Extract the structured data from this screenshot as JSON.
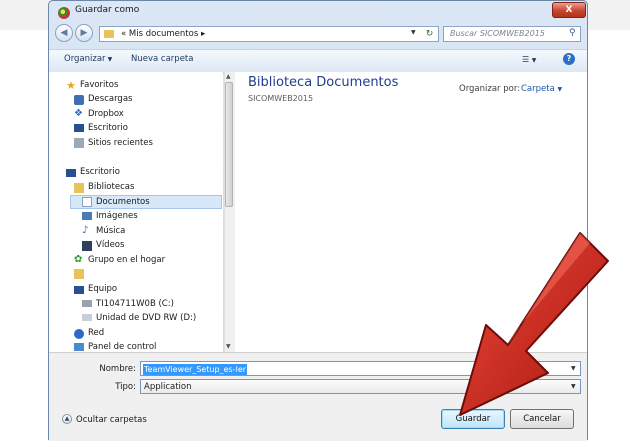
{
  "window": {
    "title": "Guardar como",
    "close_label": "X"
  },
  "address": {
    "crumb_prefix": "«",
    "crumb_label": "Mis documentos",
    "crumb_arrow": "▸",
    "search_placeholder": "Buscar SICOMWEB2015"
  },
  "toolbar": {
    "organize_label": "Organizar",
    "new_folder_label": "Nueva carpeta"
  },
  "nav": {
    "favorites": "Favoritos",
    "downloads": "Descargas",
    "dropbox": "Dropbox",
    "desktop_fav": "Escritorio",
    "recent": "Sitios recientes",
    "desktop": "Escritorio",
    "libraries": "Bibliotecas",
    "documents": "Documentos",
    "images": "Imágenes",
    "music": "Música",
    "videos": "Vídeos",
    "homegroup": "Grupo en el hogar",
    "computer": "Equipo",
    "drive_c": "TI104711W0B (C:)",
    "drive_d": "Unidad de DVD RW (D:)",
    "network": "Red",
    "control_panel": "Panel de control"
  },
  "content": {
    "library_title": "Biblioteca Documentos",
    "library_subtitle": "SICOMWEB2015",
    "arrange_label": "Organizar por:",
    "arrange_value": "Carpeta"
  },
  "form": {
    "name_label": "Nombre:",
    "name_value": "TeamViewer_Setup_es-ler",
    "type_label": "Tipo:",
    "type_value": "Application"
  },
  "footer": {
    "hide_folders_label": "Ocultar carpetas",
    "save_label": "Guardar",
    "cancel_label": "Cancelar"
  },
  "colors": {
    "arrow": "#d9261c",
    "selection": "#3399ff",
    "library_title": "#1f3f8a"
  }
}
